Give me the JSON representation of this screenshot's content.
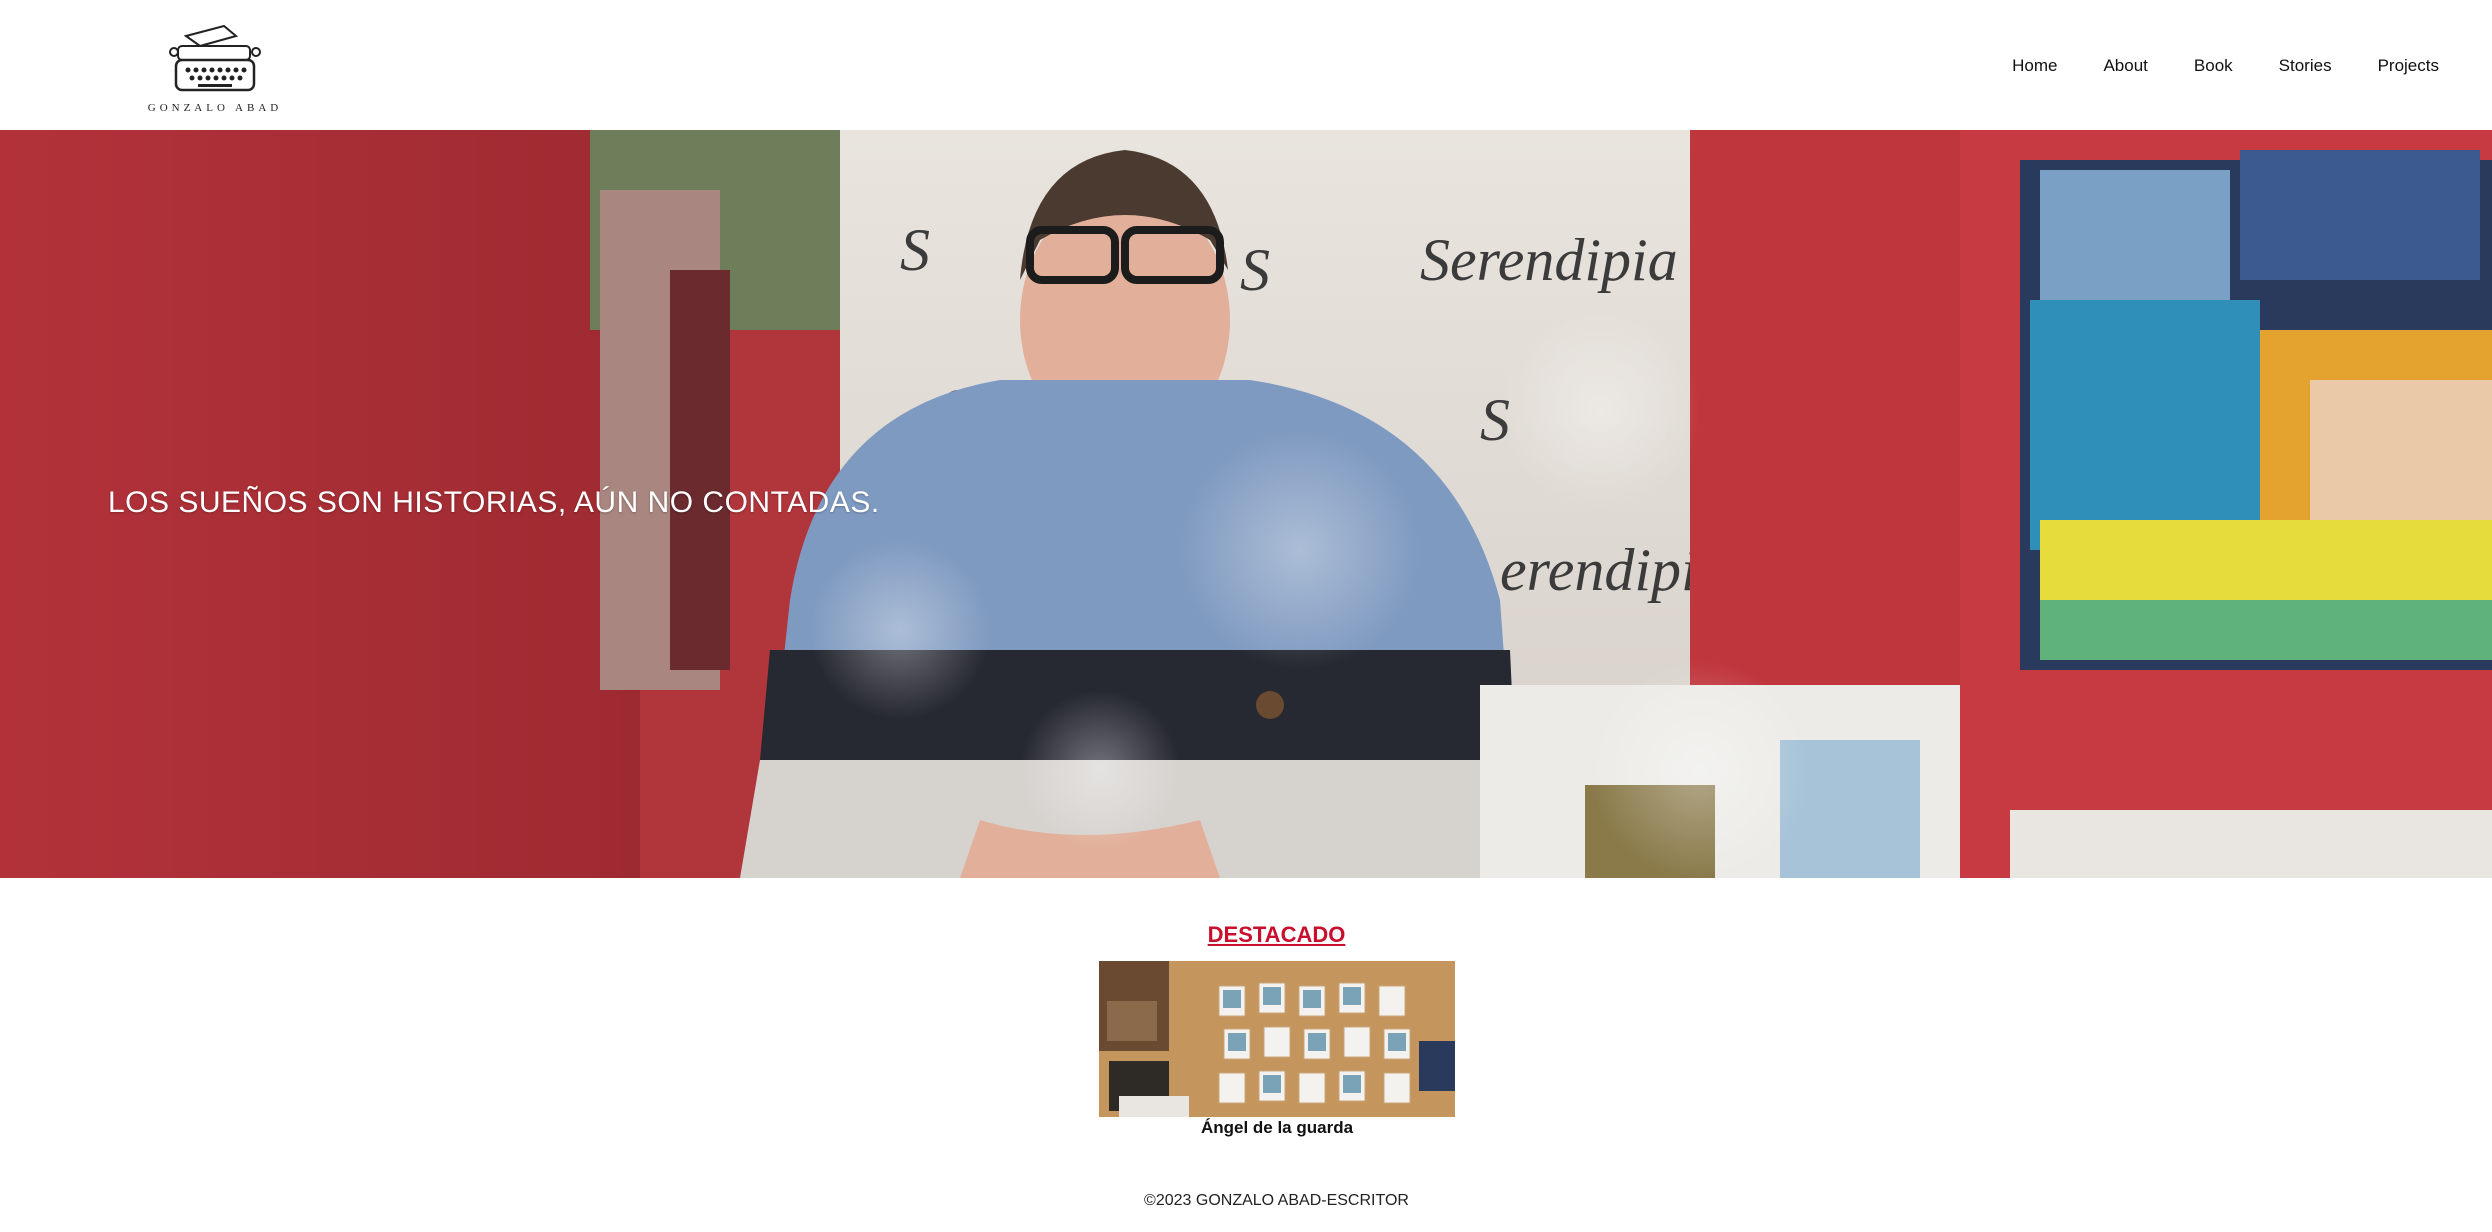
{
  "header": {
    "logo_text": "GONZALO ABAD",
    "nav": [
      "Home",
      "About",
      "Book",
      "Stories",
      "Projects"
    ]
  },
  "hero": {
    "tagline": "LOS SUEÑOS SON HISTORIAS, AÚN NO CONTADAS."
  },
  "featured": {
    "title": "DESTACADO",
    "item_caption": "Ángel de la guarda"
  },
  "footer": {
    "copyright": "©2023 GONZALO ABAD-ESCRITOR"
  },
  "colors": {
    "accent": "#c8102e",
    "hero_red": "#b0363c",
    "text": "#111111"
  }
}
